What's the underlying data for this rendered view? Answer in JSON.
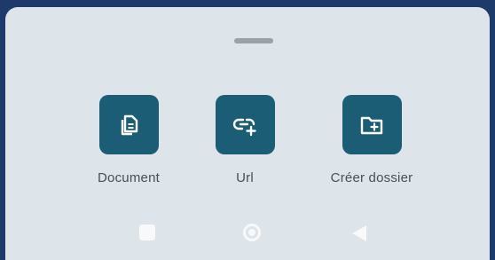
{
  "sheet": {
    "actions": [
      {
        "label": "Document",
        "icon": "document-icon"
      },
      {
        "label": "Url",
        "icon": "link-add-icon"
      },
      {
        "label": "Créer dossier",
        "icon": "folder-add-icon"
      }
    ]
  },
  "navbar": {
    "buttons": [
      {
        "name": "recent-apps-button",
        "icon": "square-icon"
      },
      {
        "name": "home-button",
        "icon": "circle-icon"
      },
      {
        "name": "back-button",
        "icon": "triangle-back-icon"
      }
    ]
  },
  "colors": {
    "accent": "#1a5d74",
    "sheet_background": "#dde4ea",
    "outer_background": "#1e3a6b",
    "label_text": "#4a4f55"
  }
}
